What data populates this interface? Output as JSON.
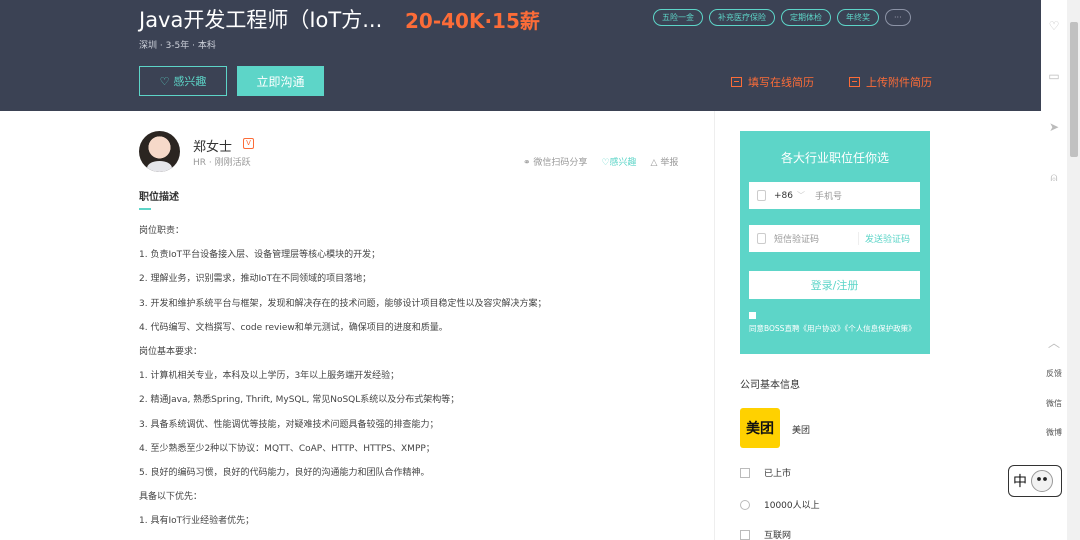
{
  "header": {
    "job_title": "Java开发工程师（IoT方...",
    "salary": "20-40K·15薪",
    "meta": "深圳 · 3-5年 · 本科",
    "tags": [
      "五险一金",
      "补充医疗保险",
      "定期体检",
      "年终奖",
      "···"
    ],
    "interest_label": "感兴趣",
    "chat_label": "立即沟通",
    "online_resume_label": "填写在线简历",
    "upload_resume_label": "上传附件简历"
  },
  "recruiter": {
    "name": "郑女士",
    "meta": "HR · 刚刚活跃",
    "share_label": "微信扫码分享",
    "interest_label": "感兴趣",
    "report_label": "举报"
  },
  "description": {
    "title": "职位描述",
    "lines": [
      "岗位职责：",
      "1. 负责IoT平台设备接入层、设备管理层等核心模块的开发；",
      "2. 理解业务，识别需求，推动IoT在不同领域的项目落地；",
      "3. 开发和维护系统平台与框架，发现和解决存在的技术问题，能够设计项目稳定性以及容灾解决方案；",
      "4. 代码编写、文档撰写、code review和单元测试，确保项目的进度和质量。",
      "岗位基本要求：",
      "1. 计算机相关专业，本科及以上学历，3年以上服务端开发经验；",
      "2. 精通Java, 熟悉Spring, Thrift, MySQL, 常见NoSQL系统以及分布式架构等；",
      "3. 具备系统调优、性能调优等技能，对疑难技术问题具备较强的排查能力；",
      "4. 至少熟悉至少2种以下协议：MQTT、CoAP、HTTP、HTTPS、XMPP；",
      "5. 良好的编码习惯，良好的代码能力，良好的沟通能力和团队合作精神。",
      "具备以下优先：",
      "1. 具有IoT行业经验者优先；"
    ]
  },
  "login": {
    "title": "各大行业职位任你选",
    "country_code": "+86",
    "phone_placeholder": "手机号",
    "code_placeholder": "短信验证码",
    "send_code_label": "发送验证码",
    "submit_label": "登录/注册",
    "agreement": "同意BOSS直聘《用户协议》《个人信息保护政策》"
  },
  "company": {
    "section_title": "公司基本信息",
    "logo_text": "美团",
    "name": "美团",
    "stage": "已上市",
    "size": "10000人以上",
    "industry": "互联网"
  },
  "sidebar": {
    "feedback_label": "反馈",
    "wechat_label": "微信",
    "weibo_label": "微博"
  },
  "ime": {
    "char": "中"
  },
  "colors": {
    "accent": "#5dd5c8",
    "salary": "#fc6c38",
    "banner": "#3b4254"
  }
}
